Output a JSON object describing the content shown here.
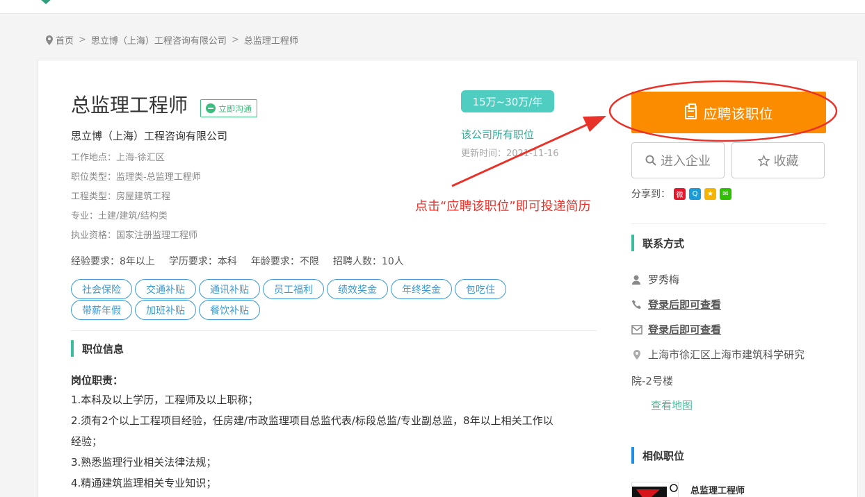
{
  "breadcrumb": {
    "home": "首页",
    "company": "思立博（上海）工程咨询有限公司",
    "current": "总监理工程师",
    "separator": ">"
  },
  "job": {
    "title": "总监理工程师",
    "chat_label": "立即沟通",
    "company": "思立博（上海）工程咨询有限公司",
    "details": [
      "工作地点：上海-徐汇区",
      "职位类型：监理类-总监理工程师",
      "工程类型：房屋建筑工程",
      "专业：土建/建筑/结构类",
      "执业资格：国家注册监理工程师"
    ],
    "salary": "15万~30万/年",
    "all_jobs_link": "该公司所有职位",
    "updated": "更新时间：2021-11-16",
    "requirements": [
      "经验要求：8年以上",
      "学历要求：本科",
      "年龄要求：不限",
      "招聘人数：10人"
    ],
    "benefits": [
      "社会保险",
      "交通补贴",
      "通讯补贴",
      "员工福利",
      "绩效奖金",
      "年终奖金",
      "包吃住",
      "带薪年假",
      "加班补贴",
      "餐饮补贴"
    ]
  },
  "position_info": {
    "heading": "职位信息",
    "duty_title": "岗位职责：",
    "lines": [
      "1.本科及以上学历，工程师及以上职称；",
      "2.须有2个以上工程项目经验，任房建/市政监理项目总监代表/标段总监/专业副总监，8年以上相关工作以",
      "经验；",
      "3.熟悉监理行业相关法律法规；",
      "4.精通建筑监理相关专业知识；"
    ]
  },
  "actions": {
    "apply_label": "应聘该职位",
    "enter_company_label": "进入企业",
    "favorite_label": "收藏",
    "share_label": "分享到："
  },
  "contact": {
    "heading": "联系方式",
    "person": "罗秀梅",
    "phone": "登录后即可查看",
    "email": "登录后即可查看",
    "address_line1": "上海市徐汇区上海市建筑科学研究",
    "address_line2": "院-2号楼",
    "map_link": "查看地图"
  },
  "similar": {
    "heading": "相似职位",
    "first_title": "总监理工程师"
  },
  "annotation": {
    "text": "点击“应聘该职位”即可投递简历"
  },
  "colors": {
    "accent_green": "#3dbd9d",
    "salary_teal": "#4ecdc0",
    "tag_blue": "#3c9ad0",
    "apply_orange": "#fb8c00",
    "annotation_red": "#e8332b"
  }
}
